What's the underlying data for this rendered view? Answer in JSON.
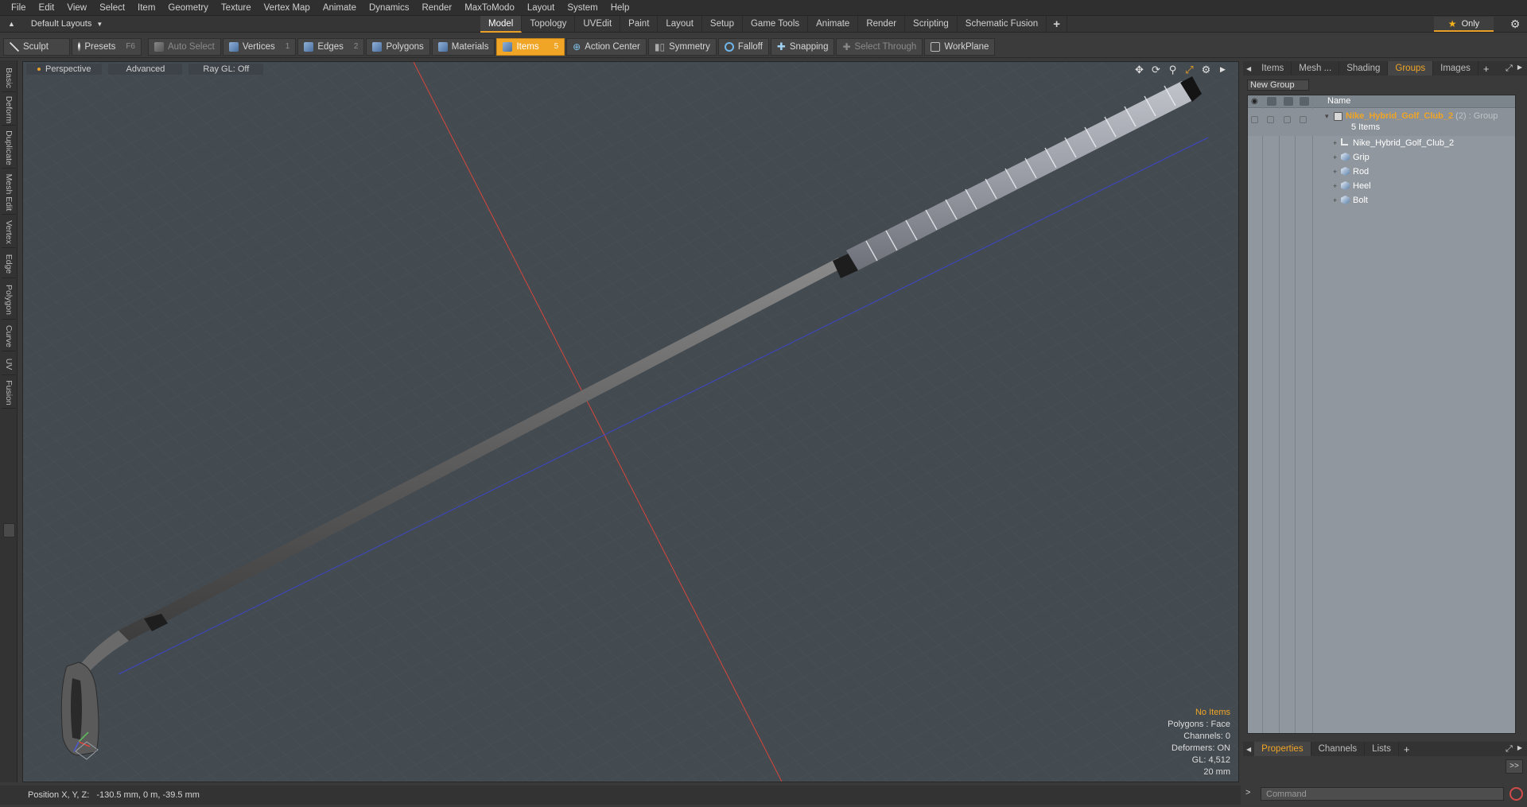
{
  "menu": [
    "File",
    "Edit",
    "View",
    "Select",
    "Item",
    "Geometry",
    "Texture",
    "Vertex Map",
    "Animate",
    "Dynamics",
    "Render",
    "MaxToModo",
    "Layout",
    "System",
    "Help"
  ],
  "layout": {
    "dropdown_label": "Default Layouts",
    "tabs": [
      "Model",
      "Topology",
      "UVEdit",
      "Paint",
      "Layout",
      "Setup",
      "Game Tools",
      "Animate",
      "Render",
      "Scripting",
      "Schematic Fusion"
    ],
    "active_tab": "Model",
    "add_tab": "+",
    "only_label": "Only"
  },
  "toolbar": {
    "sculpt": "Sculpt",
    "presets": "Presets",
    "presets_key": "F6",
    "auto_select": "Auto Select",
    "vertices": "Vertices",
    "vertices_key": "1",
    "edges": "Edges",
    "edges_key": "2",
    "polygons": "Polygons",
    "materials": "Materials",
    "items": "Items",
    "items_key": "5",
    "action_center": "Action Center",
    "symmetry": "Symmetry",
    "falloff": "Falloff",
    "snapping": "Snapping",
    "select_through": "Select Through",
    "workplane": "WorkPlane"
  },
  "left_tabs": [
    "Basic",
    "Deform",
    "Duplicate",
    "Mesh Edit",
    "Vertex",
    "Edge",
    "Polygon",
    "Curve",
    "UV",
    "Fusion"
  ],
  "viewport": {
    "view_label": "Perspective",
    "advanced_label": "Advanced",
    "raygl_label": "Ray GL: Off",
    "info": {
      "no_items": "No Items",
      "polygons": "Polygons : Face",
      "channels": "Channels: 0",
      "deformers": "Deformers: ON",
      "gl": "GL: 4,512",
      "scale": "20 mm"
    }
  },
  "status": {
    "label": "Position X, Y, Z:",
    "value": "-130.5 mm, 0 m, -39.5 mm"
  },
  "right_panel": {
    "tabs": [
      "Items",
      "Mesh ...",
      "Shading",
      "Groups",
      "Images"
    ],
    "active_tab": "Groups",
    "new_group": "New Group",
    "name_header": "Name",
    "group": {
      "name": "Nike_Hybrid_Golf_Club_2",
      "suffix": "(2) : Group",
      "count": "5 Items"
    },
    "items": [
      "Nike_Hybrid_Golf_Club_2",
      "Grip",
      "Rod",
      "Heel",
      "Bolt"
    ],
    "bottom_tabs": [
      "Properties",
      "Channels",
      "Lists"
    ],
    "bottom_active": "Properties",
    "expand_label": ">>",
    "command_placeholder": "Command",
    "command_prompt": ">"
  },
  "colors": {
    "accent": "#f0a526",
    "viewport_bg": "#434a50",
    "x_axis": "#d8463c",
    "z_axis": "#3c46c8",
    "tree_bg": "#90979e"
  }
}
